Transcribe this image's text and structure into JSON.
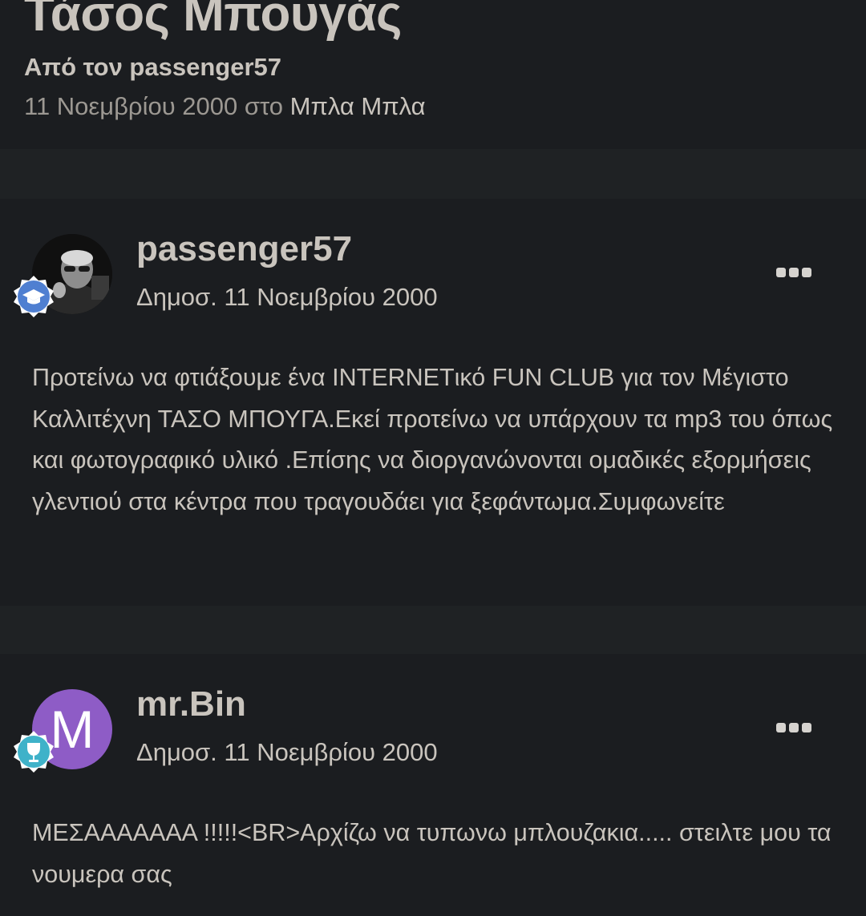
{
  "topic": {
    "title": "Τάσος Μπουγάς",
    "author_line": "Από τον passenger57",
    "date": "11 Νοεμβρίου 2000 στο",
    "forum": "Μπλα Μπλα"
  },
  "posts": [
    {
      "username": "passenger57",
      "date": "Δημοσ. 11 Νοεμβρίου 2000",
      "avatar": "photo",
      "badge_icon": "graduation-cap-icon",
      "body": "Προτείνω να φτιάξουμε ένα INTERNETικό FUN CLUB για τον Μέγιστο Καλλιτέχνη ΤΑΣΟ ΜΠΟΥΓΑ.Εκεί προτείνω να υπάρχουν τα mp3 του όπως και φωτογραφικό υλικό .Επίσης να διοργανώνονται ομαδικές εξορμήσεις γλεντιού στα κέντρα που τραγουδάει για ξεφάντωμα.Συμφωνείτε"
    },
    {
      "username": "mr.Bin",
      "date": "Δημοσ. 11 Νοεμβρίου 2000",
      "avatar_letter": "M",
      "avatar_color": "#8e5cc6",
      "badge_icon": "wine-glass-icon",
      "body": "ΜΕΣΑΑΑΑΑΑΑ !!!!!<BR>Αρχίζω να τυπωνω μπλουζακια..... στειλτε μου τα νουμερα σας"
    }
  ],
  "colors": {
    "background": "#1b1d20",
    "separator": "#1f2224",
    "text": "#c9c4bd",
    "muted": "#9c9892",
    "badge_blue": "#4f7fd1",
    "badge_teal": "#3fb2c9"
  }
}
